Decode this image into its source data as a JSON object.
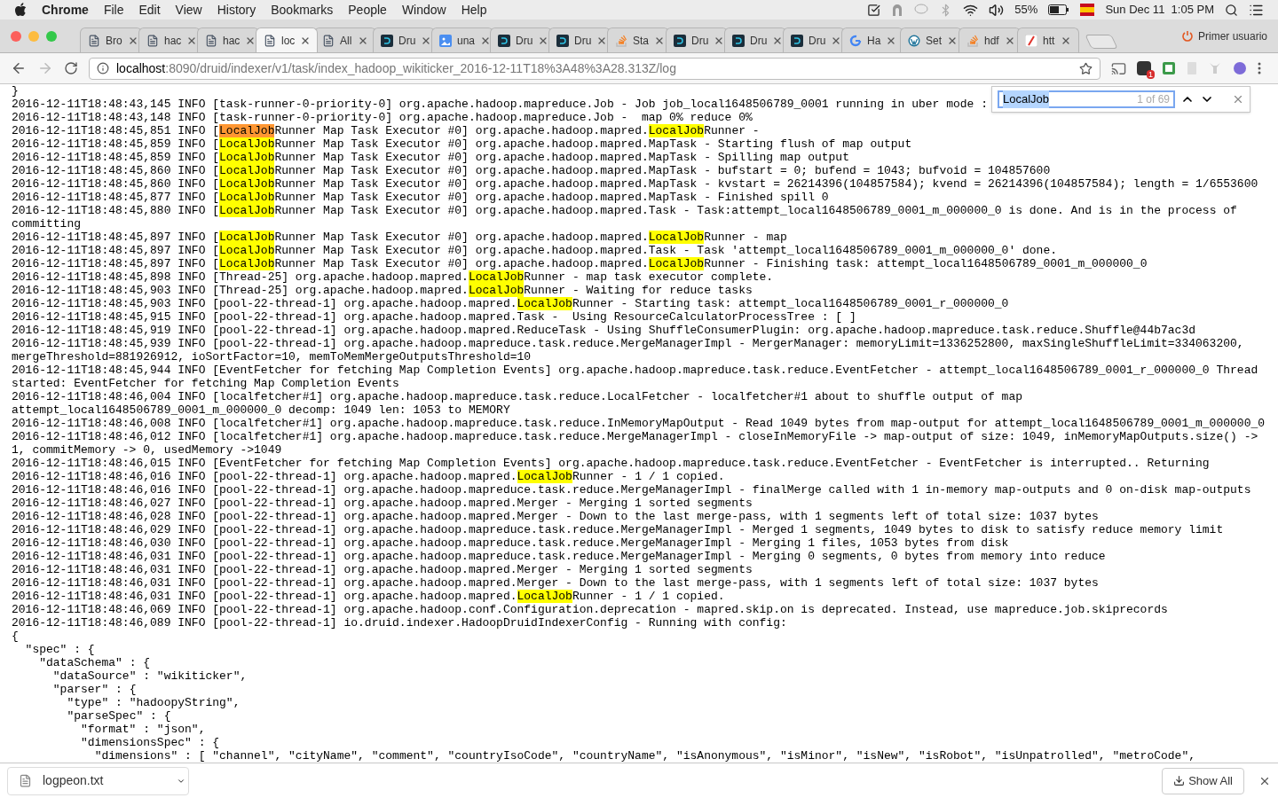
{
  "menu_bar": {
    "app": "Chrome",
    "items": [
      "File",
      "Edit",
      "View",
      "History",
      "Bookmarks",
      "People",
      "Window",
      "Help"
    ],
    "battery": "55%",
    "clock": "Sun Dec 11  1:05 PM"
  },
  "tabs": [
    {
      "title": "Bro",
      "kind": "page",
      "selected": false
    },
    {
      "title": "hac",
      "kind": "page",
      "selected": false
    },
    {
      "title": "hac",
      "kind": "page",
      "selected": false
    },
    {
      "title": "loc",
      "kind": "page",
      "selected": true
    },
    {
      "title": "All",
      "kind": "page",
      "selected": false
    },
    {
      "title": "Dru",
      "kind": "druid",
      "selected": false
    },
    {
      "title": "una",
      "kind": "image",
      "selected": false
    },
    {
      "title": "Dru",
      "kind": "druid",
      "selected": false
    },
    {
      "title": "Dru",
      "kind": "druid",
      "selected": false
    },
    {
      "title": "Sta",
      "kind": "stack",
      "selected": false
    },
    {
      "title": "Dru",
      "kind": "druid",
      "selected": false
    },
    {
      "title": "Dru",
      "kind": "druid",
      "selected": false
    },
    {
      "title": "Dru",
      "kind": "druid",
      "selected": false
    },
    {
      "title": "Ha",
      "kind": "google",
      "selected": false
    },
    {
      "title": "Set",
      "kind": "wordpress",
      "selected": false
    },
    {
      "title": "hdf",
      "kind": "stack",
      "selected": false
    },
    {
      "title": "htt",
      "kind": "slash",
      "selected": false
    }
  ],
  "profile": "Primer usuario",
  "address": {
    "host": "localhost",
    "path": ":8090/druid/indexer/v1/task/index_hadoop_wikiticker_2016-12-11T18%3A48%3A28.313Z/log"
  },
  "extension_badge": "1",
  "find_bar": {
    "value": "LocalJob",
    "count": "1 of 69"
  },
  "log_lines": [
    {
      "parts": [
        {
          "text": "}",
          "kind": "text"
        }
      ]
    },
    {
      "parts": [
        {
          "text": "2016-12-11T18:48:43,145 INFO [task-runner-0-priority-0] org.apache.hadoop.mapreduce.Job - Job job_local1648506789_0001 running in uber mode :",
          "kind": "text"
        }
      ]
    },
    {
      "parts": [
        {
          "text": "2016-12-11T18:48:43,148 INFO [task-runner-0-priority-0] org.apache.hadoop.mapreduce.Job -  map 0% reduce 0%",
          "kind": "text"
        }
      ]
    },
    {
      "parts": [
        {
          "text": "2016-12-11T18:48:45,851 INFO [",
          "kind": "text"
        },
        {
          "text": "LocalJob",
          "kind": "match",
          "selected": true
        },
        {
          "text": "Runner Map Task Executor #0] org.apache.hadoop.mapred.",
          "kind": "text"
        },
        {
          "text": "LocalJob",
          "kind": "match",
          "selected": false
        },
        {
          "text": "Runner - ",
          "kind": "text"
        }
      ]
    },
    {
      "parts": [
        {
          "text": "2016-12-11T18:48:45,859 INFO [",
          "kind": "text"
        },
        {
          "text": "LocalJob",
          "kind": "match",
          "selected": false
        },
        {
          "text": "Runner Map Task Executor #0] org.apache.hadoop.mapred.MapTask - Starting flush of map output",
          "kind": "text"
        }
      ]
    },
    {
      "parts": [
        {
          "text": "2016-12-11T18:48:45,859 INFO [",
          "kind": "text"
        },
        {
          "text": "LocalJob",
          "kind": "match",
          "selected": false
        },
        {
          "text": "Runner Map Task Executor #0] org.apache.hadoop.mapred.MapTask - Spilling map output",
          "kind": "text"
        }
      ]
    },
    {
      "parts": [
        {
          "text": "2016-12-11T18:48:45,860 INFO [",
          "kind": "text"
        },
        {
          "text": "LocalJob",
          "kind": "match",
          "selected": false
        },
        {
          "text": "Runner Map Task Executor #0] org.apache.hadoop.mapred.MapTask - bufstart = 0; bufend = 1043; bufvoid = 104857600",
          "kind": "text"
        }
      ]
    },
    {
      "parts": [
        {
          "text": "2016-12-11T18:48:45,860 INFO [",
          "kind": "text"
        },
        {
          "text": "LocalJob",
          "kind": "match",
          "selected": false
        },
        {
          "text": "Runner Map Task Executor #0] org.apache.hadoop.mapred.MapTask - kvstart = 26214396(104857584); kvend = 26214396(104857584); length = 1/6553600",
          "kind": "text"
        }
      ]
    },
    {
      "parts": [
        {
          "text": "2016-12-11T18:48:45,877 INFO [",
          "kind": "text"
        },
        {
          "text": "LocalJob",
          "kind": "match",
          "selected": false
        },
        {
          "text": "Runner Map Task Executor #0] org.apache.hadoop.mapred.MapTask - Finished spill 0",
          "kind": "text"
        }
      ]
    },
    {
      "parts": [
        {
          "text": "2016-12-11T18:48:45,880 INFO [",
          "kind": "text"
        },
        {
          "text": "LocalJob",
          "kind": "match",
          "selected": false
        },
        {
          "text": "Runner Map Task Executor #0] org.apache.hadoop.mapred.Task - Task:attempt_local1648506789_0001_m_000000_0 is done. And is in the process of committing",
          "kind": "text"
        }
      ]
    },
    {
      "parts": [
        {
          "text": "2016-12-11T18:48:45,897 INFO [",
          "kind": "text"
        },
        {
          "text": "LocalJob",
          "kind": "match",
          "selected": false
        },
        {
          "text": "Runner Map Task Executor #0] org.apache.hadoop.mapred.",
          "kind": "text"
        },
        {
          "text": "LocalJob",
          "kind": "match",
          "selected": false
        },
        {
          "text": "Runner - map",
          "kind": "text"
        }
      ]
    },
    {
      "parts": [
        {
          "text": "2016-12-11T18:48:45,897 INFO [",
          "kind": "text"
        },
        {
          "text": "LocalJob",
          "kind": "match",
          "selected": false
        },
        {
          "text": "Runner Map Task Executor #0] org.apache.hadoop.mapred.Task - Task 'attempt_local1648506789_0001_m_000000_0' done.",
          "kind": "text"
        }
      ]
    },
    {
      "parts": [
        {
          "text": "2016-12-11T18:48:45,897 INFO [",
          "kind": "text"
        },
        {
          "text": "LocalJob",
          "kind": "match",
          "selected": false
        },
        {
          "text": "Runner Map Task Executor #0] org.apache.hadoop.mapred.",
          "kind": "text"
        },
        {
          "text": "LocalJob",
          "kind": "match",
          "selected": false
        },
        {
          "text": "Runner - Finishing task: attempt_local1648506789_0001_m_000000_0",
          "kind": "text"
        }
      ]
    },
    {
      "parts": [
        {
          "text": "2016-12-11T18:48:45,898 INFO [Thread-25] org.apache.hadoop.mapred.",
          "kind": "text"
        },
        {
          "text": "LocalJob",
          "kind": "match",
          "selected": false
        },
        {
          "text": "Runner - map task executor complete.",
          "kind": "text"
        }
      ]
    },
    {
      "parts": [
        {
          "text": "2016-12-11T18:48:45,903 INFO [Thread-25] org.apache.hadoop.mapred.",
          "kind": "text"
        },
        {
          "text": "LocalJob",
          "kind": "match",
          "selected": false
        },
        {
          "text": "Runner - Waiting for reduce tasks",
          "kind": "text"
        }
      ]
    },
    {
      "parts": [
        {
          "text": "2016-12-11T18:48:45,903 INFO [pool-22-thread-1] org.apache.hadoop.mapred.",
          "kind": "text"
        },
        {
          "text": "LocalJob",
          "kind": "match",
          "selected": false
        },
        {
          "text": "Runner - Starting task: attempt_local1648506789_0001_r_000000_0",
          "kind": "text"
        }
      ]
    },
    {
      "parts": [
        {
          "text": "2016-12-11T18:48:45,915 INFO [pool-22-thread-1] org.apache.hadoop.mapred.Task -  Using ResourceCalculatorProcessTree : [ ]",
          "kind": "text"
        }
      ]
    },
    {
      "parts": [
        {
          "text": "2016-12-11T18:48:45,919 INFO [pool-22-thread-1] org.apache.hadoop.mapred.ReduceTask - Using ShuffleConsumerPlugin: org.apache.hadoop.mapreduce.task.reduce.Shuffle@44b7ac3d",
          "kind": "text"
        }
      ]
    },
    {
      "parts": [
        {
          "text": "2016-12-11T18:48:45,939 INFO [pool-22-thread-1] org.apache.hadoop.mapreduce.task.reduce.MergeManagerImpl - MergerManager: memoryLimit=1336252800, maxSingleShuffleLimit=334063200, mergeThreshold=881926912, ioSortFactor=10, memToMemMergeOutputsThreshold=10",
          "kind": "text"
        }
      ]
    },
    {
      "parts": [
        {
          "text": "2016-12-11T18:48:45,944 INFO [EventFetcher for fetching Map Completion Events] org.apache.hadoop.mapreduce.task.reduce.EventFetcher - attempt_local1648506789_0001_r_000000_0 Thread started: EventFetcher for fetching Map Completion Events",
          "kind": "text"
        }
      ]
    },
    {
      "parts": [
        {
          "text": "2016-12-11T18:48:46,004 INFO [localfetcher#1] org.apache.hadoop.mapreduce.task.reduce.LocalFetcher - localfetcher#1 about to shuffle output of map attempt_local1648506789_0001_m_000000_0 decomp: 1049 len: 1053 to MEMORY",
          "kind": "text"
        }
      ]
    },
    {
      "parts": [
        {
          "text": "2016-12-11T18:48:46,008 INFO [localfetcher#1] org.apache.hadoop.mapreduce.task.reduce.InMemoryMapOutput - Read 1049 bytes from map-output for attempt_local1648506789_0001_m_000000_0",
          "kind": "text"
        }
      ]
    },
    {
      "parts": [
        {
          "text": "2016-12-11T18:48:46,012 INFO [localfetcher#1] org.apache.hadoop.mapreduce.task.reduce.MergeManagerImpl - closeInMemoryFile -> map-output of size: 1049, inMemoryMapOutputs.size() -> 1, commitMemory -> 0, usedMemory ->1049",
          "kind": "text"
        }
      ]
    },
    {
      "parts": [
        {
          "text": "2016-12-11T18:48:46,015 INFO [EventFetcher for fetching Map Completion Events] org.apache.hadoop.mapreduce.task.reduce.EventFetcher - EventFetcher is interrupted.. Returning",
          "kind": "text"
        }
      ]
    },
    {
      "parts": [
        {
          "text": "2016-12-11T18:48:46,016 INFO [pool-22-thread-1] org.apache.hadoop.mapred.",
          "kind": "text"
        },
        {
          "text": "LocalJob",
          "kind": "match",
          "selected": false
        },
        {
          "text": "Runner - 1 / 1 copied.",
          "kind": "text"
        }
      ]
    },
    {
      "parts": [
        {
          "text": "2016-12-11T18:48:46,016 INFO [pool-22-thread-1] org.apache.hadoop.mapreduce.task.reduce.MergeManagerImpl - finalMerge called with 1 in-memory map-outputs and 0 on-disk map-outputs",
          "kind": "text"
        }
      ]
    },
    {
      "parts": [
        {
          "text": "2016-12-11T18:48:46,027 INFO [pool-22-thread-1] org.apache.hadoop.mapred.Merger - Merging 1 sorted segments",
          "kind": "text"
        }
      ]
    },
    {
      "parts": [
        {
          "text": "2016-12-11T18:48:46,028 INFO [pool-22-thread-1] org.apache.hadoop.mapred.Merger - Down to the last merge-pass, with 1 segments left of total size: 1037 bytes",
          "kind": "text"
        }
      ]
    },
    {
      "parts": [
        {
          "text": "2016-12-11T18:48:46,029 INFO [pool-22-thread-1] org.apache.hadoop.mapreduce.task.reduce.MergeManagerImpl - Merged 1 segments, 1049 bytes to disk to satisfy reduce memory limit",
          "kind": "text"
        }
      ]
    },
    {
      "parts": [
        {
          "text": "2016-12-11T18:48:46,030 INFO [pool-22-thread-1] org.apache.hadoop.mapreduce.task.reduce.MergeManagerImpl - Merging 1 files, 1053 bytes from disk",
          "kind": "text"
        }
      ]
    },
    {
      "parts": [
        {
          "text": "2016-12-11T18:48:46,031 INFO [pool-22-thread-1] org.apache.hadoop.mapreduce.task.reduce.MergeManagerImpl - Merging 0 segments, 0 bytes from memory into reduce",
          "kind": "text"
        }
      ]
    },
    {
      "parts": [
        {
          "text": "2016-12-11T18:48:46,031 INFO [pool-22-thread-1] org.apache.hadoop.mapred.Merger - Merging 1 sorted segments",
          "kind": "text"
        }
      ]
    },
    {
      "parts": [
        {
          "text": "2016-12-11T18:48:46,031 INFO [pool-22-thread-1] org.apache.hadoop.mapred.Merger - Down to the last merge-pass, with 1 segments left of total size: 1037 bytes",
          "kind": "text"
        }
      ]
    },
    {
      "parts": [
        {
          "text": "2016-12-11T18:48:46,031 INFO [pool-22-thread-1] org.apache.hadoop.mapred.",
          "kind": "text"
        },
        {
          "text": "LocalJob",
          "kind": "match",
          "selected": false
        },
        {
          "text": "Runner - 1 / 1 copied.",
          "kind": "text"
        }
      ]
    },
    {
      "parts": [
        {
          "text": "2016-12-11T18:48:46,069 INFO [pool-22-thread-1] org.apache.hadoop.conf.Configuration.deprecation - mapred.skip.on is deprecated. Instead, use mapreduce.job.skiprecords",
          "kind": "text"
        }
      ]
    },
    {
      "parts": [
        {
          "text": "2016-12-11T18:48:46,089 INFO [pool-22-thread-1] io.druid.indexer.HadoopDruidIndexerConfig - Running with config:",
          "kind": "text"
        }
      ]
    },
    {
      "parts": [
        {
          "text": "{",
          "kind": "text"
        }
      ]
    },
    {
      "parts": [
        {
          "text": "  \"spec\" : {",
          "kind": "text"
        }
      ]
    },
    {
      "parts": [
        {
          "text": "    \"dataSchema\" : {",
          "kind": "text"
        }
      ]
    },
    {
      "parts": [
        {
          "text": "      \"dataSource\" : \"wikiticker\",",
          "kind": "text"
        }
      ]
    },
    {
      "parts": [
        {
          "text": "      \"parser\" : {",
          "kind": "text"
        }
      ]
    },
    {
      "parts": [
        {
          "text": "        \"type\" : \"hadoopyString\",",
          "kind": "text"
        }
      ]
    },
    {
      "parts": [
        {
          "text": "        \"parseSpec\" : {",
          "kind": "text"
        }
      ]
    },
    {
      "parts": [
        {
          "text": "          \"format\" : \"json\",",
          "kind": "text"
        }
      ]
    },
    {
      "parts": [
        {
          "text": "          \"dimensionsSpec\" : {",
          "kind": "text"
        }
      ]
    },
    {
      "parts": [
        {
          "text": "            \"dimensions\" : [ \"channel\", \"cityName\", \"comment\", \"countryIsoCode\", \"countryName\", \"isAnonymous\", \"isMinor\", \"isNew\", \"isRobot\", \"isUnpatrolled\", \"metroCode\",",
          "kind": "text"
        }
      ]
    }
  ],
  "download": {
    "file": "logpeon.txt",
    "show_all": "Show All"
  }
}
